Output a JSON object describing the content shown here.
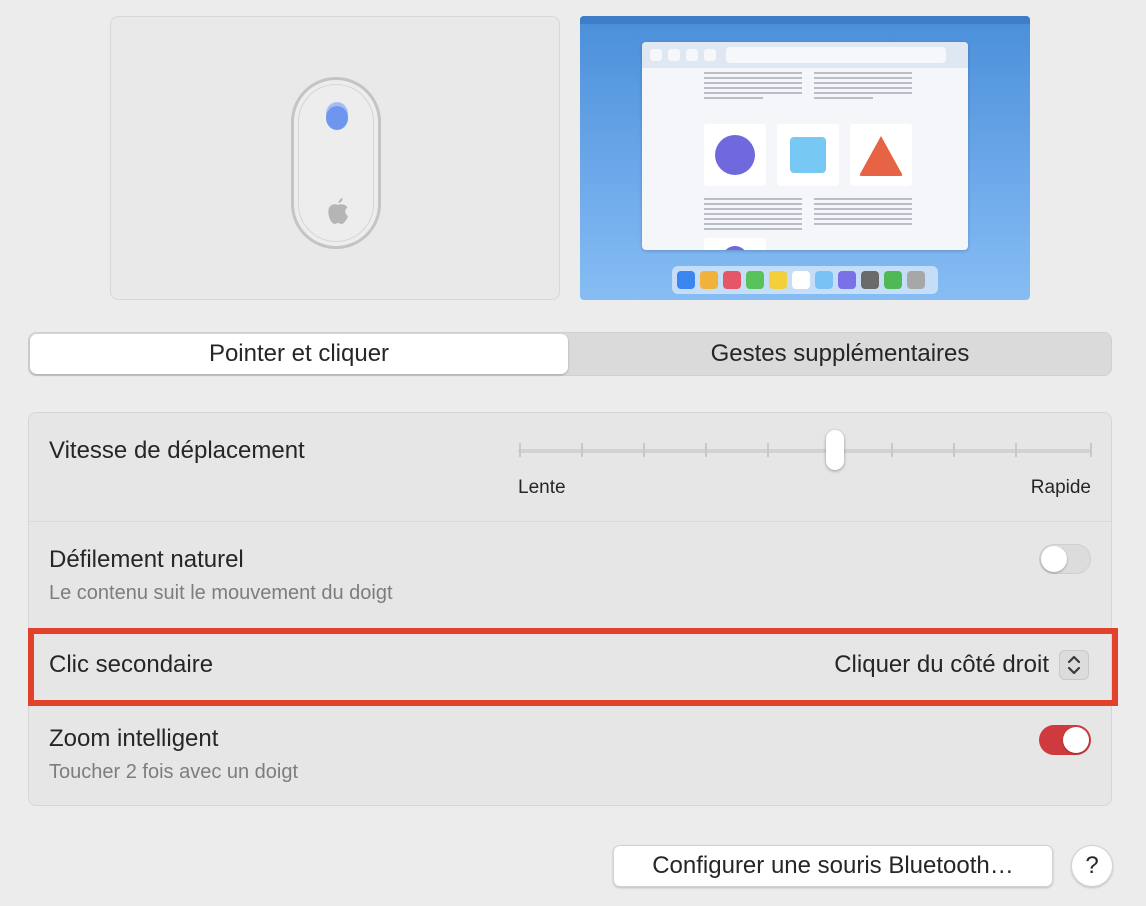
{
  "tabs": {
    "active": "Pointer et cliquer",
    "inactive": "Gestes supplémentaires"
  },
  "settings": {
    "tracking_speed": {
      "label": "Vitesse de déplacement",
      "min_label": "Lente",
      "max_label": "Rapide",
      "tick_count": 10,
      "value_fraction": 0.55
    },
    "natural_scrolling": {
      "label": "Défilement naturel",
      "description": "Le contenu suit le mouvement du doigt",
      "enabled": false
    },
    "secondary_click": {
      "label": "Clic secondaire",
      "value": "Cliquer du côté droit"
    },
    "smart_zoom": {
      "label": "Zoom intelligent",
      "description": "Toucher 2 fois avec un doigt",
      "enabled": true
    }
  },
  "buttons": {
    "bluetooth": "Configurer une souris Bluetooth…",
    "help": "?"
  },
  "colors": {
    "accent": "#cf3a3f",
    "highlight": "#e2412b",
    "mouse_dot": "#6e96ee"
  },
  "icons": {
    "mouse": "magic-mouse-icon",
    "apple": "apple-logo-icon",
    "stepper": "chevron-up-down-icon"
  }
}
